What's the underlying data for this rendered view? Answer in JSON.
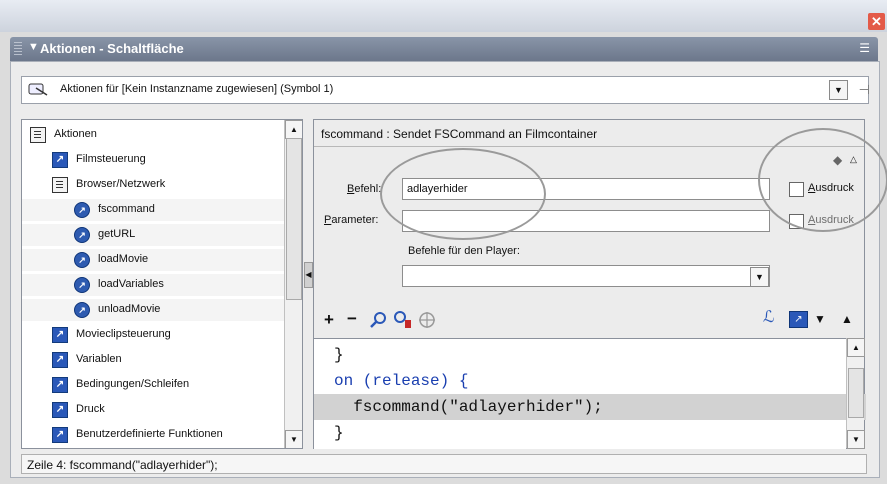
{
  "window": {
    "panel_title": "Aktionen - Schaltfläche",
    "close_glyph": "✕"
  },
  "target": {
    "label": "Aktionen für [Kein Instanzname zugewiesen] (Symbol 1)"
  },
  "tree": {
    "items": [
      {
        "label": "Aktionen",
        "icon": "book-icon",
        "level": 0
      },
      {
        "label": "Filmsteuerung",
        "icon": "action-folder-icon",
        "level": 1
      },
      {
        "label": "Browser/Netzwerk",
        "icon": "book-icon",
        "level": 1
      },
      {
        "label": "fscommand",
        "icon": "action-icon",
        "level": 2
      },
      {
        "label": "getURL",
        "icon": "action-icon",
        "level": 2
      },
      {
        "label": "loadMovie",
        "icon": "action-icon",
        "level": 2
      },
      {
        "label": "loadVariables",
        "icon": "action-icon",
        "level": 2
      },
      {
        "label": "unloadMovie",
        "icon": "action-icon",
        "level": 2
      },
      {
        "label": "Movieclipsteuerung",
        "icon": "action-folder-icon",
        "level": 1
      },
      {
        "label": "Variablen",
        "icon": "action-folder-icon",
        "level": 1
      },
      {
        "label": "Bedingungen/Schleifen",
        "icon": "action-folder-icon",
        "level": 1
      },
      {
        "label": "Druck",
        "icon": "action-folder-icon",
        "level": 1
      },
      {
        "label": "Benutzerdefinierte Funktionen",
        "icon": "action-folder-icon",
        "level": 1
      }
    ]
  },
  "params": {
    "description": "fscommand : Sendet FSCommand an Filmcontainer",
    "befehl_label_underlined": "B",
    "befehl_label_rest": "efehl:",
    "befehl_value": "adlayerhider",
    "parameter_label_underlined": "P",
    "parameter_label_rest": "arameter:",
    "parameter_value": "",
    "ausdruck1_underlined": "A",
    "ausdruck1_rest": "usdruck",
    "ausdruck2_underlined": "A",
    "ausdruck2_rest": "usdruck",
    "player_commands_label": "Befehle für den Player:",
    "player_commands_value": ""
  },
  "toolbar": {
    "add_glyph": "+",
    "remove_glyph": "−"
  },
  "code": {
    "lines": [
      "}",
      "on (release) {",
      "  fscommand(\"adlayerhider\");",
      "}"
    ]
  },
  "status": {
    "text": "Zeile 4: fscommand(\"adlayerhider\");"
  }
}
